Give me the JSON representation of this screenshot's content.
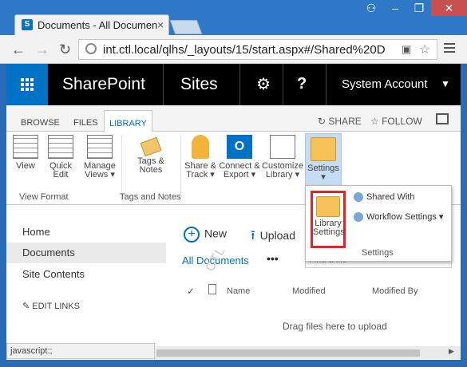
{
  "browser": {
    "tab_title": "Documents - All Documen",
    "tab_favicon": "S",
    "url": "int.ctl.local/qlhs/_layouts/15/start.aspx#/Shared%20D",
    "nav": {
      "back": "←",
      "forward": "→",
      "reload": "↻"
    },
    "window_buttons": {
      "user": "⚇",
      "minimize": "–",
      "maximize": "❐",
      "close": "✕"
    }
  },
  "suitebar": {
    "brand": "SharePoint",
    "sites": "Sites",
    "gear_icon": "⚙",
    "help": "?",
    "account": "System Account",
    "caret": "▼"
  },
  "ribbon_tabs": {
    "browse": "BROWSE",
    "files": "FILES",
    "library": "LIBRARY",
    "share": "SHARE",
    "follow": "FOLLOW"
  },
  "ribbon": {
    "view": "View",
    "quick_edit": [
      "Quick",
      "Edit"
    ],
    "manage_views": [
      "Manage",
      "Views ▾"
    ],
    "view_format": "View Format",
    "tags_notes": [
      "Tags &",
      "Notes"
    ],
    "tags_notes_group": "Tags and Notes",
    "share_track": [
      "Share &",
      "Track ▾"
    ],
    "connect_export": [
      "Connect &",
      "Export ▾"
    ],
    "customize_library": [
      "Customize",
      "Library ▾"
    ],
    "settings": [
      "Settings",
      "▾"
    ]
  },
  "settings_dropdown": {
    "library_settings": [
      "Library",
      "Settings"
    ],
    "shared_with": "Shared With",
    "workflow_settings": "Workflow Settings ▾",
    "group_label": "Settings"
  },
  "left_nav": {
    "home": "Home",
    "documents": "Documents",
    "site_contents": "Site Contents",
    "edit_links": "EDIT LINKS"
  },
  "main": {
    "new": "New",
    "upload": "Upload",
    "view_name": "All Documents",
    "ellipsis": "•••",
    "find_placeholder": "Find a file",
    "columns": {
      "check": "✓",
      "name": "Name",
      "modified": "Modified",
      "modified_by": "Modified By"
    },
    "drag_text": "Drag files here to upload",
    "watermark": "CTL"
  },
  "status": {
    "text": "javascript:;"
  },
  "colors": {
    "suite_blue": "#0072c6",
    "suite_black": "#000000",
    "highlight_red": "#e2242b",
    "titlebar": "#2e78c7"
  }
}
